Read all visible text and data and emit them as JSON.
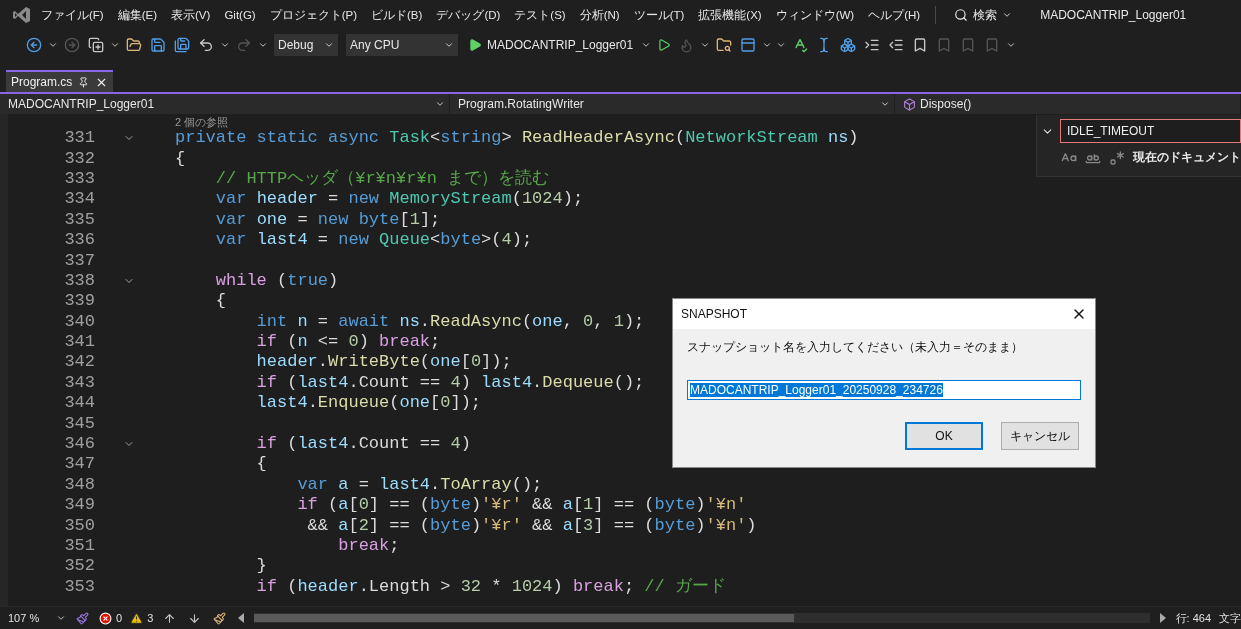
{
  "menu": {
    "items": [
      "ファイル(F)",
      "編集(E)",
      "表示(V)",
      "Git(G)",
      "プロジェクト(P)",
      "ビルド(B)",
      "デバッグ(D)",
      "テスト(S)",
      "分析(N)",
      "ツール(T)",
      "拡張機能(X)",
      "ウィンドウ(W)",
      "ヘルプ(H)"
    ],
    "search": "検索",
    "title": "MADOCANTRIP_Logger01"
  },
  "toolbar": {
    "configuration": "Debug",
    "platform": "Any CPU",
    "start": "MADOCANTRIP_Logger01"
  },
  "tabs": [
    {
      "label": "Program.cs",
      "selected": true
    }
  ],
  "navigation": {
    "project": "MADOCANTRIP_Logger01",
    "type": "Program.RotatingWriter",
    "member": "Dispose()"
  },
  "editor": {
    "codelens": "2 個の参照",
    "lines": [
      {
        "number": "331",
        "foldable": true,
        "tokens": [
          {
            "kind": "kw",
            "text": "private static async "
          },
          {
            "kind": "type",
            "text": "Task"
          },
          {
            "kind": "plain",
            "text": "<"
          },
          {
            "kind": "kw",
            "text": "string"
          },
          {
            "kind": "plain",
            "text": "> "
          },
          {
            "kind": "method",
            "text": "ReadHeaderAsync"
          },
          {
            "kind": "plain",
            "text": "("
          },
          {
            "kind": "type",
            "text": "NetworkStream "
          },
          {
            "kind": "var",
            "text": "ns"
          },
          {
            "kind": "plain",
            "text": ")"
          }
        ]
      },
      {
        "number": "332",
        "foldable": false,
        "tokens": [
          {
            "kind": "plain",
            "text": "{"
          }
        ]
      },
      {
        "number": "333",
        "foldable": false,
        "tokens": [
          {
            "kind": "comment",
            "text": "    // HTTPヘッダ（¥r¥n¥r¥n まで）を読む"
          }
        ]
      },
      {
        "number": "334",
        "foldable": false,
        "tokens": [
          {
            "kind": "kw",
            "text": "    var "
          },
          {
            "kind": "var",
            "text": "header"
          },
          {
            "kind": "plain",
            "text": " = "
          },
          {
            "kind": "kw",
            "text": "new "
          },
          {
            "kind": "type",
            "text": "MemoryStream"
          },
          {
            "kind": "plain",
            "text": "("
          },
          {
            "kind": "num",
            "text": "1024"
          },
          {
            "kind": "plain",
            "text": ");"
          }
        ]
      },
      {
        "number": "335",
        "foldable": false,
        "tokens": [
          {
            "kind": "kw",
            "text": "    var "
          },
          {
            "kind": "var",
            "text": "one"
          },
          {
            "kind": "plain",
            "text": " = "
          },
          {
            "kind": "kw",
            "text": "new byte"
          },
          {
            "kind": "plain",
            "text": "["
          },
          {
            "kind": "num",
            "text": "1"
          },
          {
            "kind": "plain",
            "text": "];"
          }
        ]
      },
      {
        "number": "336",
        "foldable": false,
        "tokens": [
          {
            "kind": "kw",
            "text": "    var "
          },
          {
            "kind": "var",
            "text": "last4"
          },
          {
            "kind": "plain",
            "text": " = "
          },
          {
            "kind": "kw",
            "text": "new "
          },
          {
            "kind": "type",
            "text": "Queue"
          },
          {
            "kind": "plain",
            "text": "<"
          },
          {
            "kind": "kw",
            "text": "byte"
          },
          {
            "kind": "plain",
            "text": ">("
          },
          {
            "kind": "num",
            "text": "4"
          },
          {
            "kind": "plain",
            "text": ");"
          }
        ]
      },
      {
        "number": "337",
        "foldable": false
      },
      {
        "number": "338",
        "foldable": true,
        "tokens": [
          {
            "kind": "ctrl",
            "text": "    while "
          },
          {
            "kind": "plain",
            "text": "("
          },
          {
            "kind": "kw",
            "text": "true"
          },
          {
            "kind": "plain",
            "text": ")"
          }
        ]
      },
      {
        "number": "339",
        "foldable": false,
        "tokens": [
          {
            "kind": "plain",
            "text": "    {"
          }
        ]
      },
      {
        "number": "340",
        "foldable": false,
        "tokens": [
          {
            "kind": "kw",
            "text": "        int "
          },
          {
            "kind": "var",
            "text": "n"
          },
          {
            "kind": "plain",
            "text": " = "
          },
          {
            "kind": "kw",
            "text": "await "
          },
          {
            "kind": "var",
            "text": "ns"
          },
          {
            "kind": "plain",
            "text": "."
          },
          {
            "kind": "method",
            "text": "ReadAsync"
          },
          {
            "kind": "plain",
            "text": "("
          },
          {
            "kind": "var",
            "text": "one"
          },
          {
            "kind": "plain",
            "text": ", "
          },
          {
            "kind": "num",
            "text": "0"
          },
          {
            "kind": "plain",
            "text": ", "
          },
          {
            "kind": "num",
            "text": "1"
          },
          {
            "kind": "plain",
            "text": ");"
          }
        ]
      },
      {
        "number": "341",
        "foldable": false,
        "tokens": [
          {
            "kind": "ctrl",
            "text": "        if "
          },
          {
            "kind": "plain",
            "text": "("
          },
          {
            "kind": "var",
            "text": "n"
          },
          {
            "kind": "plain",
            "text": " <= "
          },
          {
            "kind": "num",
            "text": "0"
          },
          {
            "kind": "plain",
            "text": ") "
          },
          {
            "kind": "ctrl",
            "text": "break"
          },
          {
            "kind": "plain",
            "text": ";"
          }
        ]
      },
      {
        "number": "342",
        "foldable": false,
        "tokens": [
          {
            "kind": "var",
            "text": "        header"
          },
          {
            "kind": "plain",
            "text": "."
          },
          {
            "kind": "method",
            "text": "WriteByte"
          },
          {
            "kind": "plain",
            "text": "("
          },
          {
            "kind": "var",
            "text": "one"
          },
          {
            "kind": "plain",
            "text": "["
          },
          {
            "kind": "num",
            "text": "0"
          },
          {
            "kind": "plain",
            "text": "]);"
          }
        ]
      },
      {
        "number": "343",
        "foldable": false,
        "tokens": [
          {
            "kind": "ctrl",
            "text": "        if "
          },
          {
            "kind": "plain",
            "text": "("
          },
          {
            "kind": "var",
            "text": "last4"
          },
          {
            "kind": "plain",
            "text": ".Count == "
          },
          {
            "kind": "num",
            "text": "4"
          },
          {
            "kind": "plain",
            "text": ") "
          },
          {
            "kind": "var",
            "text": "last4"
          },
          {
            "kind": "plain",
            "text": "."
          },
          {
            "kind": "method",
            "text": "Dequeue"
          },
          {
            "kind": "plain",
            "text": "();"
          }
        ]
      },
      {
        "number": "344",
        "foldable": false,
        "tokens": [
          {
            "kind": "var",
            "text": "        last4"
          },
          {
            "kind": "plain",
            "text": "."
          },
          {
            "kind": "method",
            "text": "Enqueue"
          },
          {
            "kind": "plain",
            "text": "("
          },
          {
            "kind": "var",
            "text": "one"
          },
          {
            "kind": "plain",
            "text": "["
          },
          {
            "kind": "num",
            "text": "0"
          },
          {
            "kind": "plain",
            "text": "]);"
          }
        ]
      },
      {
        "number": "345",
        "foldable": false
      },
      {
        "number": "346",
        "foldable": true,
        "tokens": [
          {
            "kind": "ctrl",
            "text": "        if "
          },
          {
            "kind": "plain",
            "text": "("
          },
          {
            "kind": "var",
            "text": "last4"
          },
          {
            "kind": "plain",
            "text": ".Count == "
          },
          {
            "kind": "num",
            "text": "4"
          },
          {
            "kind": "plain",
            "text": ")"
          }
        ]
      },
      {
        "number": "347",
        "foldable": false,
        "tokens": [
          {
            "kind": "plain",
            "text": "        {"
          }
        ]
      },
      {
        "number": "348",
        "foldable": false,
        "tokens": [
          {
            "kind": "kw",
            "text": "            var "
          },
          {
            "kind": "var",
            "text": "a"
          },
          {
            "kind": "plain",
            "text": " = "
          },
          {
            "kind": "var",
            "text": "last4"
          },
          {
            "kind": "plain",
            "text": "."
          },
          {
            "kind": "method",
            "text": "ToArray"
          },
          {
            "kind": "plain",
            "text": "();"
          }
        ]
      },
      {
        "number": "349",
        "foldable": false,
        "tokens": [
          {
            "kind": "ctrl",
            "text": "            if "
          },
          {
            "kind": "plain",
            "text": "("
          },
          {
            "kind": "var",
            "text": "a"
          },
          {
            "kind": "plain",
            "text": "["
          },
          {
            "kind": "num",
            "text": "0"
          },
          {
            "kind": "plain",
            "text": "] == ("
          },
          {
            "kind": "kw",
            "text": "byte"
          },
          {
            "kind": "plain",
            "text": ")"
          },
          {
            "kind": "str",
            "text": "'¥r'"
          },
          {
            "kind": "plain",
            "text": " && "
          },
          {
            "kind": "var",
            "text": "a"
          },
          {
            "kind": "plain",
            "text": "["
          },
          {
            "kind": "num",
            "text": "1"
          },
          {
            "kind": "plain",
            "text": "] == ("
          },
          {
            "kind": "kw",
            "text": "byte"
          },
          {
            "kind": "plain",
            "text": ")"
          },
          {
            "kind": "str",
            "text": "'¥n'"
          }
        ]
      },
      {
        "number": "350",
        "foldable": false,
        "tokens": [
          {
            "kind": "plain",
            "text": "             && "
          },
          {
            "kind": "var",
            "text": "a"
          },
          {
            "kind": "plain",
            "text": "["
          },
          {
            "kind": "num",
            "text": "2"
          },
          {
            "kind": "plain",
            "text": "] == ("
          },
          {
            "kind": "kw",
            "text": "byte"
          },
          {
            "kind": "plain",
            "text": ")"
          },
          {
            "kind": "str",
            "text": "'¥r'"
          },
          {
            "kind": "plain",
            "text": " && "
          },
          {
            "kind": "var",
            "text": "a"
          },
          {
            "kind": "plain",
            "text": "["
          },
          {
            "kind": "num",
            "text": "3"
          },
          {
            "kind": "plain",
            "text": "] == ("
          },
          {
            "kind": "kw",
            "text": "byte"
          },
          {
            "kind": "plain",
            "text": ")"
          },
          {
            "kind": "str",
            "text": "'¥n'"
          },
          {
            "kind": "plain",
            "text": ")"
          }
        ]
      },
      {
        "number": "351",
        "foldable": false,
        "tokens": [
          {
            "kind": "ctrl",
            "text": "                break"
          },
          {
            "kind": "plain",
            "text": ";"
          }
        ]
      },
      {
        "number": "352",
        "foldable": false,
        "tokens": [
          {
            "kind": "plain",
            "text": "        }"
          }
        ]
      },
      {
        "number": "353",
        "foldable": false,
        "tokens": [
          {
            "kind": "ctrl",
            "text": "        if "
          },
          {
            "kind": "plain",
            "text": "("
          },
          {
            "kind": "var",
            "text": "header"
          },
          {
            "kind": "plain",
            "text": ".Length > "
          },
          {
            "kind": "num",
            "text": "32"
          },
          {
            "kind": "plain",
            "text": " * "
          },
          {
            "kind": "num",
            "text": "1024"
          },
          {
            "kind": "plain",
            "text": ") "
          },
          {
            "kind": "ctrl",
            "text": "break"
          },
          {
            "kind": "plain",
            "text": "; "
          },
          {
            "kind": "comment",
            "text": "// ガード"
          }
        ]
      }
    ]
  },
  "find": {
    "value": "IDLE_TIMEOUT",
    "scope": "現在のドキュメント"
  },
  "dialog": {
    "title": "SNAPSHOT",
    "message": "スナップショット名を入力してください（未入力＝そのまま）",
    "value": "MADOCANTRIP_Logger01_20250928_234726",
    "text_selected": true,
    "buttons": [
      {
        "label": "OK",
        "default": true
      },
      {
        "label": "キャンセル",
        "default": false
      }
    ]
  },
  "status_bar": {
    "zoom": "107 %",
    "errors": "0",
    "warnings": "3",
    "line": "行: 464",
    "column": "文字"
  }
}
